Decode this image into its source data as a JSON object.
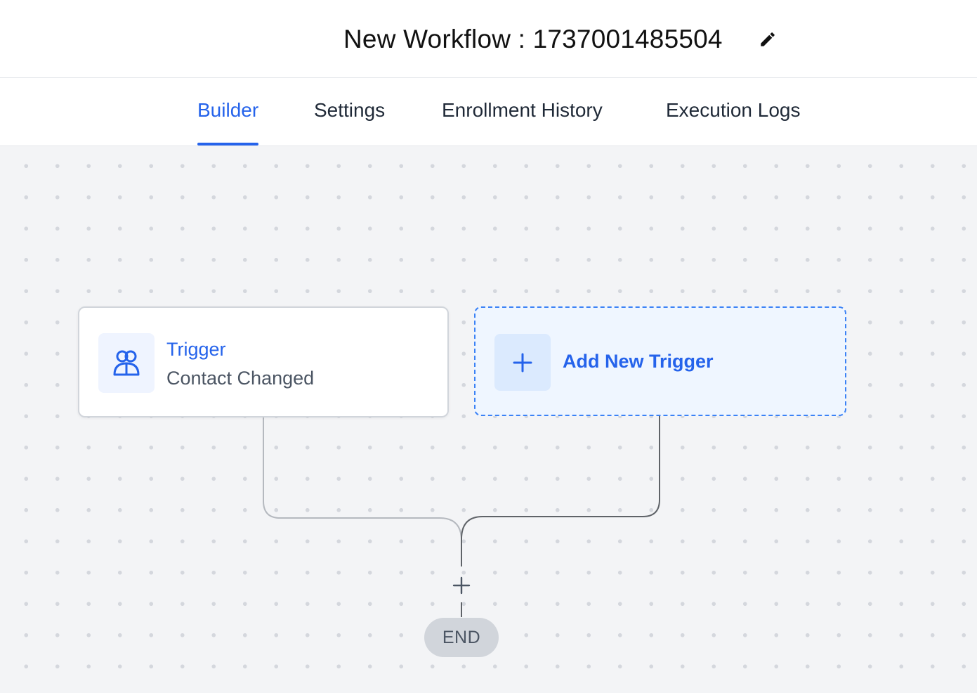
{
  "header": {
    "title": "New Workflow : 1737001485504",
    "edit_icon": "pencil-icon"
  },
  "tabs": [
    {
      "label": "Builder",
      "active": true
    },
    {
      "label": "Settings",
      "active": false
    },
    {
      "label": "Enrollment History",
      "active": false
    },
    {
      "label": "Execution Logs",
      "active": false
    }
  ],
  "canvas": {
    "trigger": {
      "title": "Trigger",
      "subtitle": "Contact Changed",
      "icon": "users-icon"
    },
    "add_trigger": {
      "label": "Add New Trigger",
      "icon": "plus-icon"
    },
    "add_step_icon": "plus-icon",
    "end_label": "END"
  },
  "colors": {
    "accent": "#2563eb",
    "canvas_bg": "#f3f4f6",
    "add_trigger_bg": "#eff6ff",
    "add_trigger_border": "#3b82f6",
    "end_pill_bg": "#d1d5db"
  }
}
